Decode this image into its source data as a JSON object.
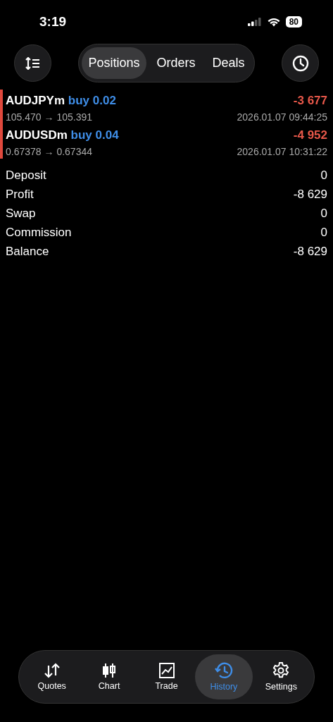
{
  "status_bar": {
    "time": "3:19",
    "battery": "80"
  },
  "tabs": [
    {
      "label": "Positions",
      "selected": true
    },
    {
      "label": "Orders",
      "selected": false
    },
    {
      "label": "Deals",
      "selected": false
    }
  ],
  "deals": [
    {
      "symbol": "AUDJPYm",
      "side": "buy 0.02",
      "profit": "-3 677",
      "prices": "105.470 → 105.391",
      "time": "2026.01.07 09:44:25"
    },
    {
      "symbol": "AUDUSDm",
      "side": "buy 0.04",
      "profit": "-4 952",
      "prices": "0.67378 → 0.67344",
      "time": "2026.01.07 10:31:22"
    }
  ],
  "summary": [
    {
      "label": "Deposit",
      "value": "0"
    },
    {
      "label": "Profit",
      "value": "-8 629"
    },
    {
      "label": "Swap",
      "value": "0"
    },
    {
      "label": "Commission",
      "value": "0"
    },
    {
      "label": "Balance",
      "value": "-8 629"
    }
  ],
  "nav": [
    {
      "kind": "quotes",
      "label": "Quotes",
      "selected": false
    },
    {
      "kind": "chart",
      "label": "Chart",
      "selected": false
    },
    {
      "kind": "trade",
      "label": "Trade",
      "selected": false
    },
    {
      "kind": "history",
      "label": "History",
      "selected": true
    },
    {
      "kind": "settings",
      "label": "Settings",
      "selected": false
    }
  ]
}
